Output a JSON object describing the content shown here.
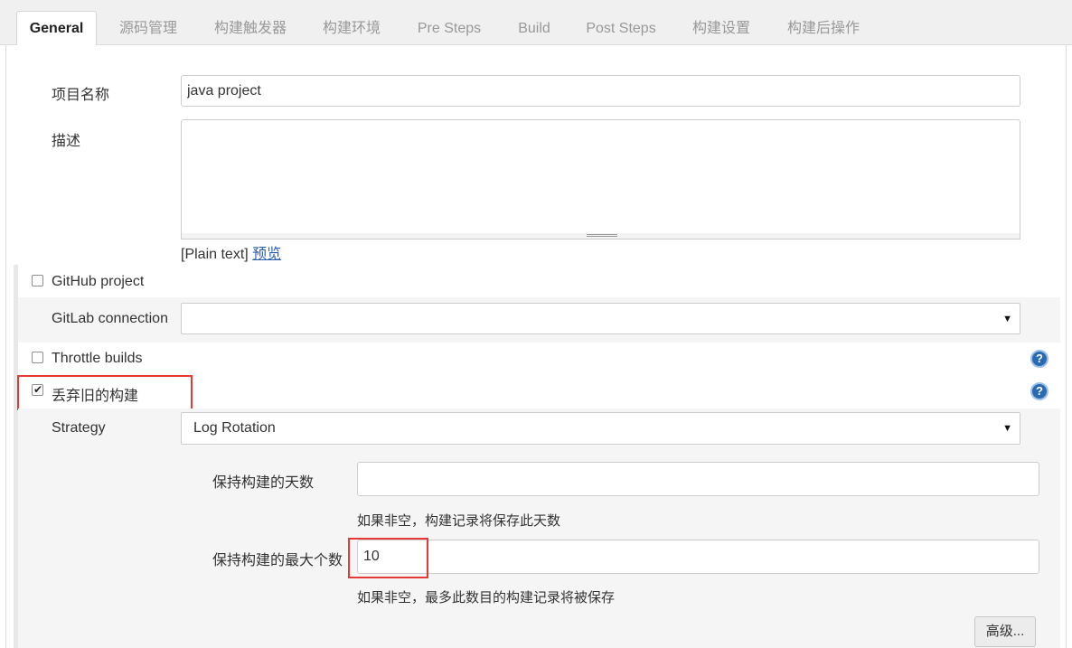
{
  "tabs": [
    {
      "label": "General",
      "active": true
    },
    {
      "label": "源码管理"
    },
    {
      "label": "构建触发器"
    },
    {
      "label": "构建环境"
    },
    {
      "label": "Pre Steps"
    },
    {
      "label": "Build"
    },
    {
      "label": "Post Steps"
    },
    {
      "label": "构建设置"
    },
    {
      "label": "构建后操作"
    }
  ],
  "project_name": {
    "label": "项目名称",
    "value": "java project"
  },
  "description": {
    "label": "描述",
    "value": "",
    "format_text": "[Plain text]",
    "preview_link": "预览"
  },
  "github_project": {
    "label": "GitHub project",
    "checked": false
  },
  "gitlab_connection": {
    "label": "GitLab connection",
    "value": ""
  },
  "throttle_builds": {
    "label": "Throttle builds",
    "checked": false
  },
  "discard_old_builds": {
    "label": "丢弃旧的构建",
    "checked": true,
    "check_mark": "✔"
  },
  "help_icon": "?",
  "strategy": {
    "label": "Strategy",
    "value": "Log Rotation",
    "days_to_keep": {
      "label": "保持构建的天数",
      "value": "",
      "hint": "如果非空，构建记录将保存此天数"
    },
    "max_to_keep": {
      "label": "保持构建的最大个数",
      "value": "10",
      "hint": "如果非空，最多此数目的构建记录将被保存"
    }
  },
  "advanced_button": "高级...",
  "select_arrow": "▼",
  "colors": {
    "highlight": "#e53935",
    "link": "#2a5db0",
    "help": "#2a6ab3"
  }
}
